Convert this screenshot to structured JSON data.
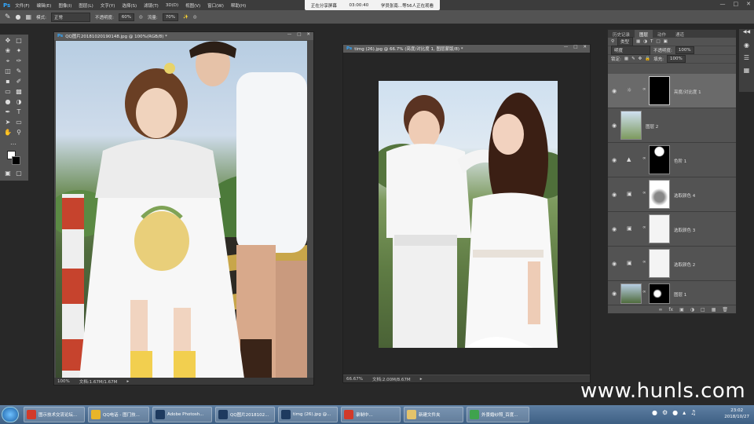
{
  "menubar": {
    "logo": "Ps",
    "items": [
      "文件(F)",
      "编辑(E)",
      "图像(I)",
      "图层(L)",
      "文字(Y)",
      "选择(S)",
      "滤镜(T)",
      "3D(D)",
      "视图(V)",
      "窗口(W)",
      "帮助(H)"
    ]
  },
  "share_banner": {
    "status": "正在分享屏幕",
    "time": "03:00:40",
    "viewers": "学员张南...等56人正在观看"
  },
  "options_bar": {
    "mode_label": "模式:",
    "mode_value": "正常",
    "opacity_label": "不透明度:",
    "opacity_value": "60%",
    "flow_label": "流量:",
    "flow_value": "70%"
  },
  "doc1": {
    "title": "QQ图片20181020190148.jpg @ 100%(RGB/8) *",
    "zoom": "100%",
    "doc_size": "文档:1.67M/1.67M"
  },
  "doc2": {
    "title": "timg (26).jpg @ 66.7% (亮度/对比度 1, 图层蒙版/8) *",
    "zoom": "66.67%",
    "doc_size": "文档:2.00M/8.67M"
  },
  "layers_panel": {
    "tabs": [
      "历史记录",
      "图层",
      "动作",
      "通道"
    ],
    "active_tab": "图层",
    "filter_kind": "类型",
    "blend_mode": "明度",
    "opacity_label": "不透明度:",
    "opacity_value": "100%",
    "lock_label": "锁定:",
    "fill_label": "填充:",
    "fill_value": "100%",
    "layers": [
      {
        "name": "亮度/对比度 1",
        "type": "adjustment",
        "selected": true
      },
      {
        "name": "图层 2",
        "type": "pixel",
        "selected": false
      },
      {
        "name": "色阶 1",
        "type": "adjustment",
        "selected": false
      },
      {
        "name": "选取颜色 4",
        "type": "adjustment",
        "selected": false
      },
      {
        "name": "选取颜色 3",
        "type": "adjustment",
        "selected": false
      },
      {
        "name": "选取颜色 2",
        "type": "adjustment",
        "selected": false
      },
      {
        "name": "图层 1",
        "type": "pixel",
        "selected": false
      }
    ]
  },
  "watermark": "www.hunls.com",
  "taskbar": {
    "items": [
      {
        "label": "图示技术交流论坛...",
        "color": "#d23a2a"
      },
      {
        "label": "QQ电话 - 图门技...",
        "color": "#e8b52a"
      },
      {
        "label": "Adobe Photosh...",
        "color": "#1e3a5f"
      },
      {
        "label": "QQ图片2018102...",
        "color": "#1e3a5f"
      },
      {
        "label": "timg (26).jpg @...",
        "color": "#1e3a5f"
      },
      {
        "label": "录制中...",
        "color": "#d23a2a"
      },
      {
        "label": "新建文件夹",
        "color": "#e3c36b"
      },
      {
        "label": "外景婚纱照_百度...",
        "color": "#3fa34d"
      }
    ],
    "time": "23:02",
    "date": "2018/10/27"
  }
}
